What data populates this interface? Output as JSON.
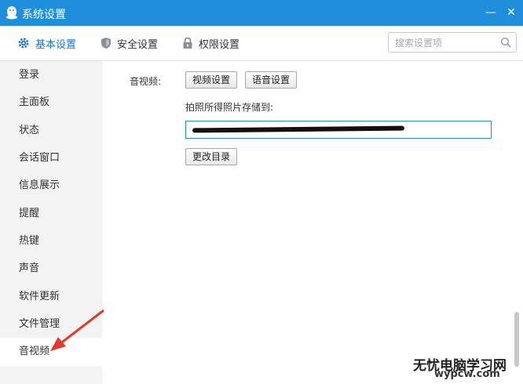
{
  "window": {
    "title": "系统设置",
    "minimize_label": "—",
    "close_label": "✕"
  },
  "tabs": [
    {
      "label": "基本设置",
      "icon": "gear-icon",
      "active": true
    },
    {
      "label": "安全设置",
      "icon": "shield-icon",
      "active": false
    },
    {
      "label": "权限设置",
      "icon": "lock-icon",
      "active": false
    }
  ],
  "search": {
    "placeholder": "搜索设置项",
    "value": ""
  },
  "sidebar": {
    "items": [
      {
        "label": "登录"
      },
      {
        "label": "主面板"
      },
      {
        "label": "状态"
      },
      {
        "label": "会话窗口"
      },
      {
        "label": "信息展示"
      },
      {
        "label": "提醒"
      },
      {
        "label": "热键"
      },
      {
        "label": "声音"
      },
      {
        "label": "软件更新"
      },
      {
        "label": "文件管理"
      },
      {
        "label": "音视频",
        "active": true
      }
    ]
  },
  "content": {
    "section_label": "音视频:",
    "video_button": "视频设置",
    "voice_button": "语音设置",
    "photo_path_label": "拍照所得照片存储到:",
    "change_dir_button": "更改目录"
  },
  "watermark": {
    "text": "无忧电脑学习网",
    "url": "wypcw.com"
  },
  "colors": {
    "titlebar": "#1f8fdc",
    "active_tab": "#1a74c4",
    "arrow": "#e23a2c"
  }
}
